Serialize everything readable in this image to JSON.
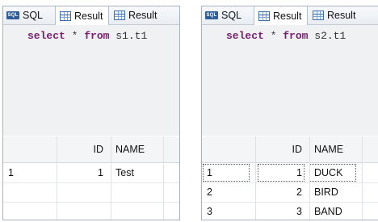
{
  "panels": [
    {
      "tabs": {
        "sql": "SQL",
        "result1": "Result",
        "result2": "Result"
      },
      "sql": {
        "keyword_select": "select",
        "star": "*",
        "keyword_from": "from",
        "table": "s1.t1"
      },
      "columns": {
        "row": "",
        "id": "ID",
        "name": "NAME"
      },
      "rows": [
        {
          "row": "1",
          "id": "1",
          "name": "Test"
        }
      ]
    },
    {
      "tabs": {
        "sql": "SQL",
        "result1": "Result",
        "result2": "Result"
      },
      "sql": {
        "keyword_select": "select",
        "star": "*",
        "keyword_from": "from",
        "table": "s2.t1"
      },
      "columns": {
        "row": "",
        "id": "ID",
        "name": "NAME"
      },
      "rows": [
        {
          "row": "1",
          "id": "1",
          "name": "DUCK"
        },
        {
          "row": "2",
          "id": "2",
          "name": "BIRD"
        },
        {
          "row": "3",
          "id": "3",
          "name": "BAND"
        }
      ]
    }
  ],
  "icons": {
    "sql_tab": "sql-icon",
    "result_tab": "grid-icon"
  },
  "colors": {
    "keyword": "#7a1f6e",
    "editor_bg": "#f0f1f3",
    "tab_icon": "#2f5d9a"
  }
}
